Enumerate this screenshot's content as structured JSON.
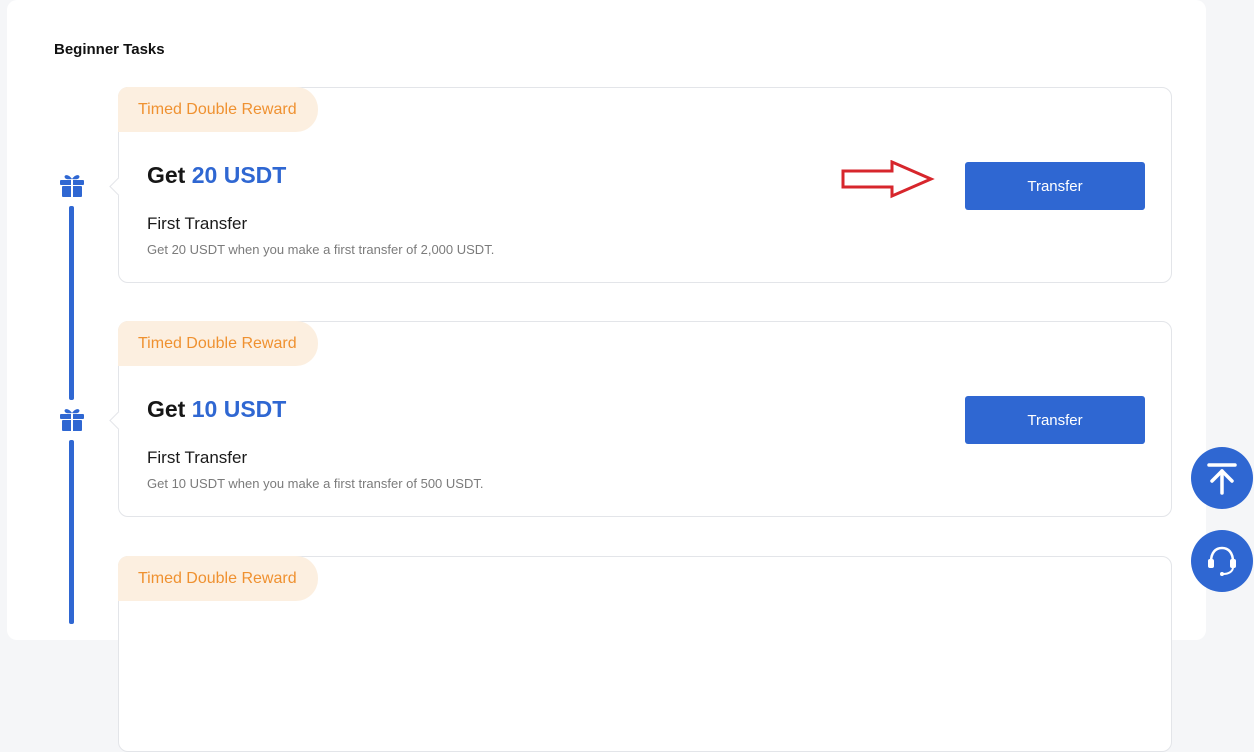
{
  "section": {
    "title": "Beginner Tasks"
  },
  "tasks": [
    {
      "badge": "Timed Double Reward",
      "reward_prefix": "Get ",
      "reward_amount": "20 USDT",
      "name": "First Transfer",
      "description": "Get 20 USDT when you make a first transfer of 2,000 USDT.",
      "button_label": "Transfer"
    },
    {
      "badge": "Timed Double Reward",
      "reward_prefix": "Get ",
      "reward_amount": "10 USDT",
      "name": "First Transfer",
      "description": "Get 10 USDT when you make a first transfer of 500 USDT.",
      "button_label": "Transfer"
    },
    {
      "badge": "Timed Double Reward"
    }
  ],
  "floating_buttons": [
    {
      "icon": "arrow-up-to-top-icon"
    },
    {
      "icon": "headset-support-icon"
    }
  ],
  "colors": {
    "accent": "#2f67d2",
    "badge_bg": "#fcefe0",
    "badge_text": "#ef9130",
    "annotation_arrow": "#d7262c"
  }
}
